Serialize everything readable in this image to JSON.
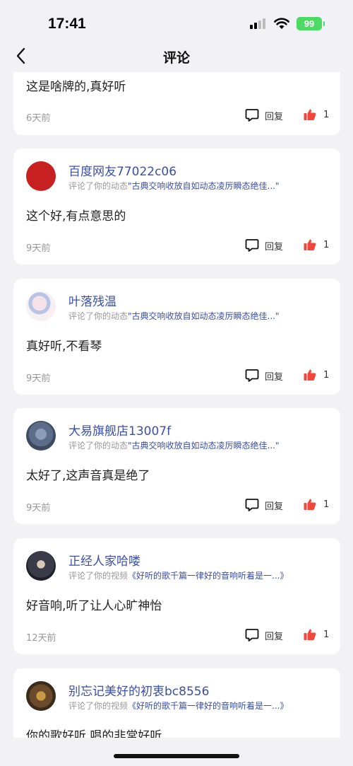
{
  "status_bar": {
    "time": "17:41",
    "battery": "99"
  },
  "nav": {
    "title": "评论"
  },
  "comments": [
    {
      "username": "",
      "action": "",
      "ref": "",
      "text": "这是啥牌的,真好听",
      "date": "6天前",
      "reply_label": "回复",
      "likes": "1"
    },
    {
      "username": "百度网友77022c06",
      "action": "评论了你的动态",
      "ref": "\"古典交响收放自如动态凌厉瞬态绝佳...\"",
      "text": "这个好,有点意思的",
      "date": "9天前",
      "reply_label": "回复",
      "likes": "1"
    },
    {
      "username": "叶落残温",
      "action": "评论了你的动态",
      "ref": "\"古典交响收放自如动态凌厉瞬态绝佳...\"",
      "text": "真好听,不看琴",
      "date": "9天前",
      "reply_label": "回复",
      "likes": "1"
    },
    {
      "username": "大易旗舰店13007f",
      "action": "评论了你的动态",
      "ref": "\"古典交响收放自如动态凌厉瞬态绝佳...\"",
      "text": "太好了,这声音真是绝了",
      "date": "9天前",
      "reply_label": "回复",
      "likes": "1"
    },
    {
      "username": "正经人家哈喽",
      "action": "评论了你的视频",
      "ref": "《好听的歌千篇一律好的音响听着是一...》",
      "text": "好音响,听了让人心旷神怡",
      "date": "12天前",
      "reply_label": "回复",
      "likes": "1"
    },
    {
      "username": "别忘记美好的初衷bc8556",
      "action": "评论了你的视频",
      "ref": "《好听的歌千篇一律好的音响听着是一...》",
      "text": "你的歌好听,唱的非常好听",
      "date": "",
      "reply_label": "",
      "likes": ""
    }
  ]
}
